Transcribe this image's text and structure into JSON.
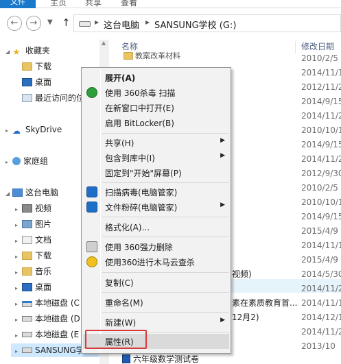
{
  "ribbon": {
    "tabs": [
      "文件",
      "主页",
      "共享",
      "查看"
    ]
  },
  "address_bar": {
    "crumbs": [
      "这台电脑",
      "SANSUNG学校 (G:)"
    ]
  },
  "nav_pane": {
    "items": [
      {
        "label": "收藏夹",
        "icon": "star-icon"
      },
      {
        "label": "下载",
        "icon": "folder-icon"
      },
      {
        "label": "桌面",
        "icon": "desktop-icon"
      },
      {
        "label": "最近访问的位",
        "icon": "recent-icon"
      },
      {
        "label": "SkyDrive",
        "icon": "cloud-icon"
      },
      {
        "label": "家庭组",
        "icon": "homegroup-icon"
      },
      {
        "label": "这台电脑",
        "icon": "computer-icon"
      },
      {
        "label": "视频",
        "icon": "video-icon"
      },
      {
        "label": "图片",
        "icon": "picture-icon"
      },
      {
        "label": "文档",
        "icon": "document-icon"
      },
      {
        "label": "下载",
        "icon": "download-icon"
      },
      {
        "label": "音乐",
        "icon": "music-icon"
      },
      {
        "label": "桌面",
        "icon": "desktop-icon"
      },
      {
        "label": "本地磁盘 (C",
        "icon": "system-disk-icon"
      },
      {
        "label": "本地磁盘 (D",
        "icon": "disk-icon"
      },
      {
        "label": "本地磁盘 (E",
        "icon": "disk-icon"
      },
      {
        "label": "SANSUNG学",
        "icon": "usb-disk-icon"
      }
    ]
  },
  "file_list": {
    "columns": {
      "name": "名称",
      "date": "修改日期"
    },
    "partial_names": [
      "教案改革材料",
      "视频)",
      "素在素质教育首...",
      "12月2)",
      "六年级数学测试卷"
    ],
    "dates": [
      "2010/2/5",
      "2014/11/1",
      "2012/11/2",
      "2014/9/15",
      "2014/11/2",
      "2010/10/1",
      "2014/9/15",
      "2014/11/2",
      "2012/9/30",
      "2010/2/5",
      "2010/10/1",
      "2014/9/15",
      "2015/4/9",
      "2014/11/1",
      "2015/4/9",
      "2014/5/30",
      "2014/11/2",
      "2014/11/1",
      "2014/12/1",
      "2014/11/2",
      "2013/10"
    ]
  },
  "context_menu": {
    "items": [
      {
        "label": "展开(A)",
        "bold": true
      },
      {
        "label": "使用 360杀毒 扫描",
        "icon": "antivirus-360-icon"
      },
      {
        "label": "在新窗口中打开(E)"
      },
      {
        "label": "启用 BitLocker(B)"
      },
      {
        "label": "共享(H)",
        "submenu": true
      },
      {
        "label": "包含到库中(I)",
        "submenu": true
      },
      {
        "label": "固定到\"开始\"屏幕(P)"
      },
      {
        "label": "扫描病毒(电脑管家)",
        "icon": "pc-manager-icon"
      },
      {
        "label": "文件粉碎(电脑管家)",
        "icon": "pc-manager-icon",
        "submenu": true
      },
      {
        "label": "格式化(A)..."
      },
      {
        "label": "使用 360强力删除",
        "icon": "shredder-360-icon"
      },
      {
        "label": "使用360进行木马云查杀",
        "icon": "trojan-scan-360-icon"
      },
      {
        "label": "复制(C)"
      },
      {
        "label": "重命名(M)"
      },
      {
        "label": "新建(W)",
        "submenu": true
      },
      {
        "label": "属性(R)"
      }
    ],
    "highlighted": "属性(R)"
  },
  "colors": {
    "accent": "#1979ca",
    "highlight_box": "#d83b3b",
    "selection": "#cde8ff"
  }
}
